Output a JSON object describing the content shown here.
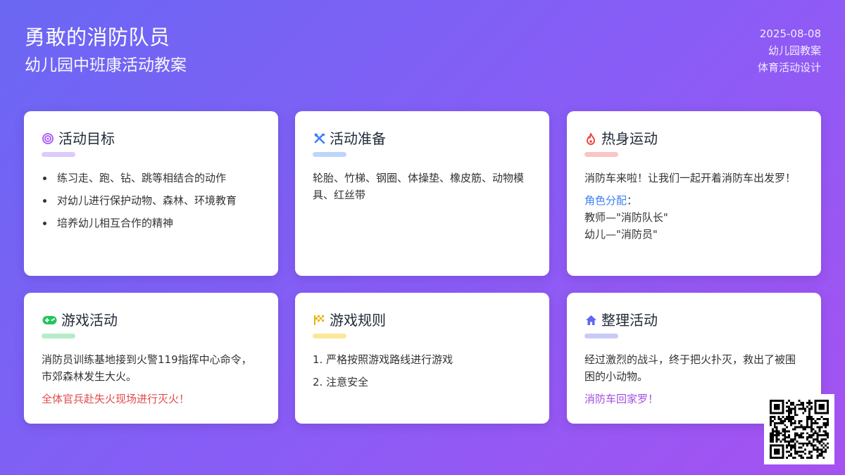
{
  "header": {
    "title": "勇敢的消防队员",
    "subtitle": "幼儿园中班康活动教案"
  },
  "meta": {
    "date": "2025-08-08",
    "category": "幼儿园教案",
    "type": "体育活动设计"
  },
  "cards": {
    "goals": {
      "title": "活动目标",
      "icon": "target-icon",
      "color": "#a855f7",
      "bar_color": "#dccbfb",
      "items": [
        "练习走、跑、钻、跳等相结合的动作",
        "对幼儿进行保护动物、森林、环境教育",
        "培养幼儿相互合作的精神"
      ]
    },
    "prep": {
      "title": "活动准备",
      "icon": "tools-icon",
      "color": "#3b82f6",
      "bar_color": "#bcd6fb",
      "text": "轮胎、竹梯、钢圈、体操垫、橡皮筋、动物模具、红丝带"
    },
    "warmup": {
      "title": "热身运动",
      "icon": "fire-icon",
      "color": "#ef4444",
      "bar_color": "#f9c5c5",
      "text": "消防车来啦！让我们一起开着消防车出发罗！",
      "roles_label": "角色分配",
      "roles_colon": "：",
      "role1": "教师—\"消防队长\"",
      "role2": "幼儿—\"消防员\""
    },
    "game": {
      "title": "游戏活动",
      "icon": "gamepad-icon",
      "color": "#22c55e",
      "bar_color": "#b7ecc8",
      "text": "消防员训练基地接到火警119指挥中心命令，市郊森林发生大火。",
      "highlight": "全体官兵赴失火现场进行灭火！"
    },
    "rules": {
      "title": "游戏规则",
      "icon": "flag-icon",
      "color": "#eab308",
      "bar_color": "#fbe79a",
      "items": [
        "1. 严格按照游戏路线进行游戏",
        "2. 注意安全"
      ]
    },
    "wrapup": {
      "title": "整理活动",
      "icon": "home-icon",
      "color": "#6366f1",
      "bar_color": "#c9cbf7",
      "text": "经过激烈的战斗，终于把火扑灭，救出了被围困的小动物。",
      "highlight": "消防车回家罗！"
    }
  },
  "qr": {
    "icon": "qr-code-icon"
  }
}
